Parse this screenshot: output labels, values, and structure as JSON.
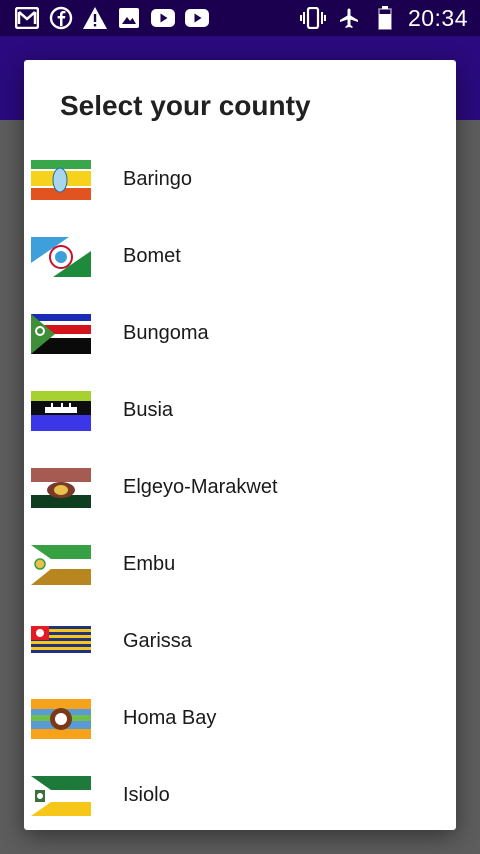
{
  "status_bar": {
    "time": "20:34",
    "icons": [
      "gmail-icon",
      "facebook-icon",
      "warning-icon",
      "image-icon",
      "youtube-icon",
      "youtube-icon",
      "vibrate-icon",
      "airplane-mode-icon",
      "battery-icon"
    ]
  },
  "dialog": {
    "title": "Select your county",
    "counties": [
      {
        "name": "Baringo"
      },
      {
        "name": "Bomet"
      },
      {
        "name": "Bungoma"
      },
      {
        "name": "Busia"
      },
      {
        "name": "Elgeyo-Marakwet"
      },
      {
        "name": "Embu"
      },
      {
        "name": "Garissa"
      },
      {
        "name": "Homa Bay"
      },
      {
        "name": "Isiolo"
      }
    ]
  },
  "colors": {
    "status_bar": "#1a004f",
    "app_bar": "#2a0a7e",
    "scrim": "#5d5d5d"
  }
}
